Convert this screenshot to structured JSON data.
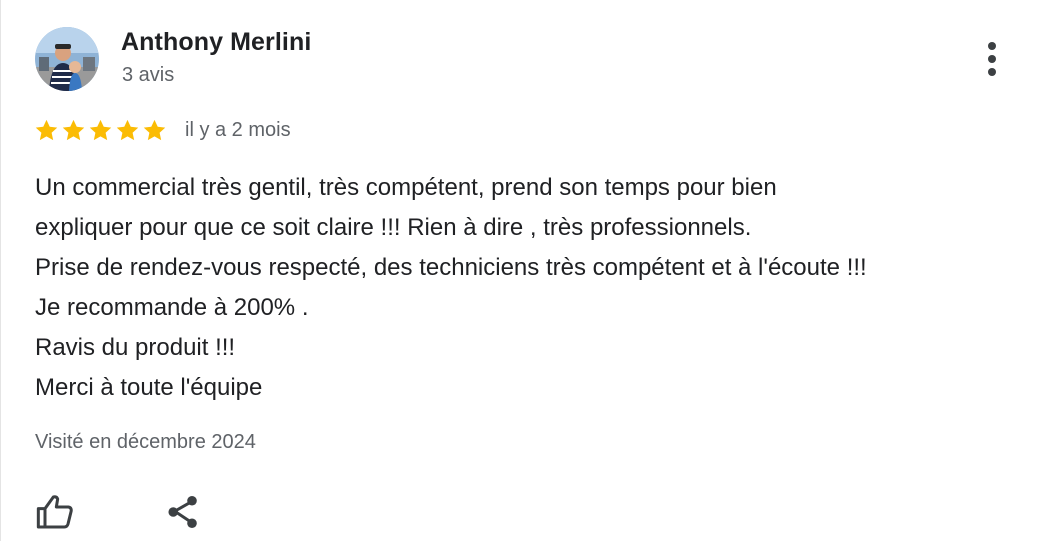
{
  "review": {
    "author": {
      "name": "Anthony Merlini",
      "meta": "3 avis",
      "avatar": "avatar"
    },
    "menu_icon": "more-vert-icon",
    "rating": {
      "stars": 5,
      "max_stars": 5,
      "star_color": "#fbbc04"
    },
    "date": "il y a 2 mois",
    "text_lines": [
      "Un commercial très gentil, très compétent, prend son temps pour bien",
      "expliquer pour que ce soit claire !!! Rien à dire , très professionnels.",
      "Prise de rendez-vous respecté, des techniciens très compétent et à l'écoute !!!",
      "Je recommande à 200% .",
      "Ravis du produit !!!",
      "Merci à toute l'équipe"
    ],
    "visited": "Visité en décembre 2024",
    "actions": {
      "like_icon": "thumb-up-icon",
      "share_icon": "share-icon"
    }
  }
}
